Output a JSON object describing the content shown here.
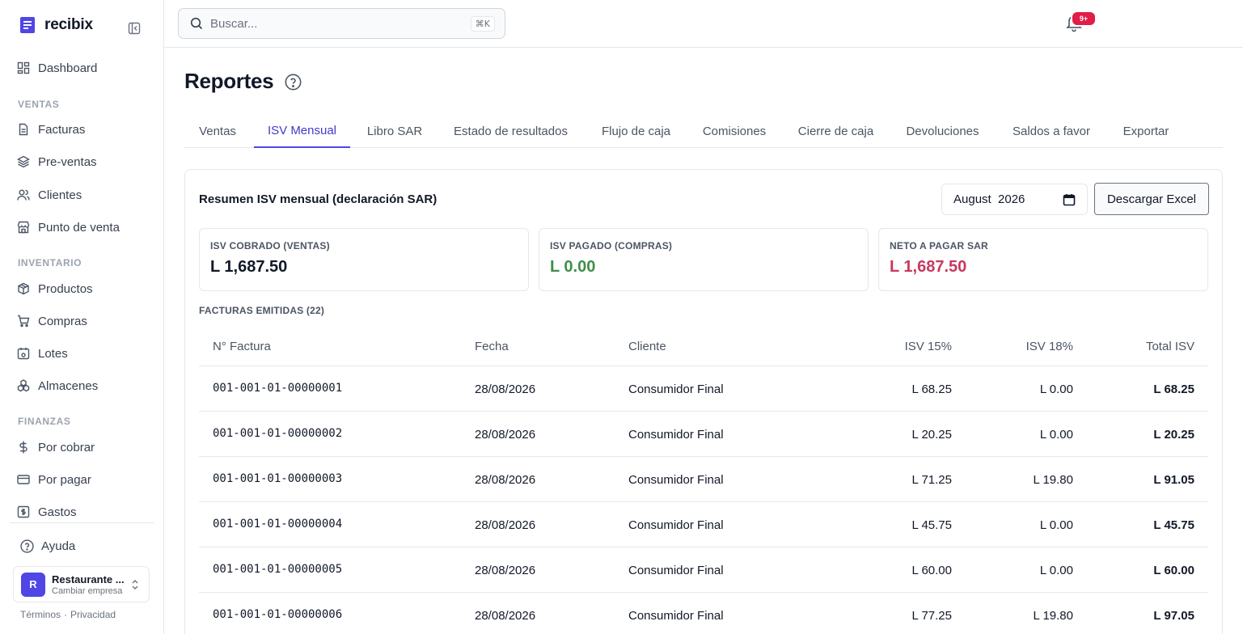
{
  "brand": {
    "name": "recibix"
  },
  "sidebar": {
    "dashboard": "Dashboard",
    "sections": [
      {
        "title": "VENTAS",
        "items": [
          "Facturas",
          "Pre-ventas",
          "Clientes",
          "Punto de venta"
        ]
      },
      {
        "title": "INVENTARIO",
        "items": [
          "Productos",
          "Compras",
          "Lotes",
          "Almacenes"
        ]
      },
      {
        "title": "FINANZAS",
        "items": [
          "Por cobrar",
          "Por pagar",
          "Gastos"
        ]
      }
    ],
    "help": "Ayuda",
    "company": {
      "initial": "R",
      "name": "Restaurante ...",
      "subtitle": "Cambiar empresa"
    },
    "legal": {
      "terms": "Términos",
      "separator": "·",
      "privacy": "Privacidad"
    }
  },
  "topbar": {
    "search_placeholder": "Buscar...",
    "search_shortcut": "⌘K",
    "notifications_badge": "9+"
  },
  "page": {
    "title": "Reportes"
  },
  "tabs": [
    "Ventas",
    "ISV Mensual",
    "Libro SAR",
    "Estado de resultados",
    "Flujo de caja",
    "Comisiones",
    "Cierre de caja",
    "Devoluciones",
    "Saldos a favor",
    "Exportar"
  ],
  "active_tab": "ISV Mensual",
  "report": {
    "title": "Resumen ISV mensual (declaración SAR)",
    "month_value": "August  2026",
    "download_label": "Descargar Excel",
    "stats": [
      {
        "label": "ISV COBRADO (VENTAS)",
        "value": "L 1,687.50",
        "color": "#111827"
      },
      {
        "label": "ISV PAGADO (COMPRAS)",
        "value": "L 0.00",
        "color": "#3f8f4a"
      },
      {
        "label": "NETO A PAGAR SAR",
        "value": "L 1,687.50",
        "color": "#c8385e"
      }
    ],
    "invoices_label": "FACTURAS EMITIDAS (22)",
    "columns": [
      "N° Factura",
      "Fecha",
      "Cliente",
      "ISV 15%",
      "ISV 18%",
      "Total ISV"
    ],
    "rows": [
      [
        "001-001-01-00000001",
        "28/08/2026",
        "Consumidor Final",
        "L 68.25",
        "L 0.00",
        "L 68.25"
      ],
      [
        "001-001-01-00000002",
        "28/08/2026",
        "Consumidor Final",
        "L 20.25",
        "L 0.00",
        "L 20.25"
      ],
      [
        "001-001-01-00000003",
        "28/08/2026",
        "Consumidor Final",
        "L 71.25",
        "L 19.80",
        "L 91.05"
      ],
      [
        "001-001-01-00000004",
        "28/08/2026",
        "Consumidor Final",
        "L 45.75",
        "L 0.00",
        "L 45.75"
      ],
      [
        "001-001-01-00000005",
        "28/08/2026",
        "Consumidor Final",
        "L 60.00",
        "L 0.00",
        "L 60.00"
      ],
      [
        "001-001-01-00000006",
        "28/08/2026",
        "Consumidor Final",
        "L 77.25",
        "L 19.80",
        "L 97.05"
      ]
    ]
  }
}
